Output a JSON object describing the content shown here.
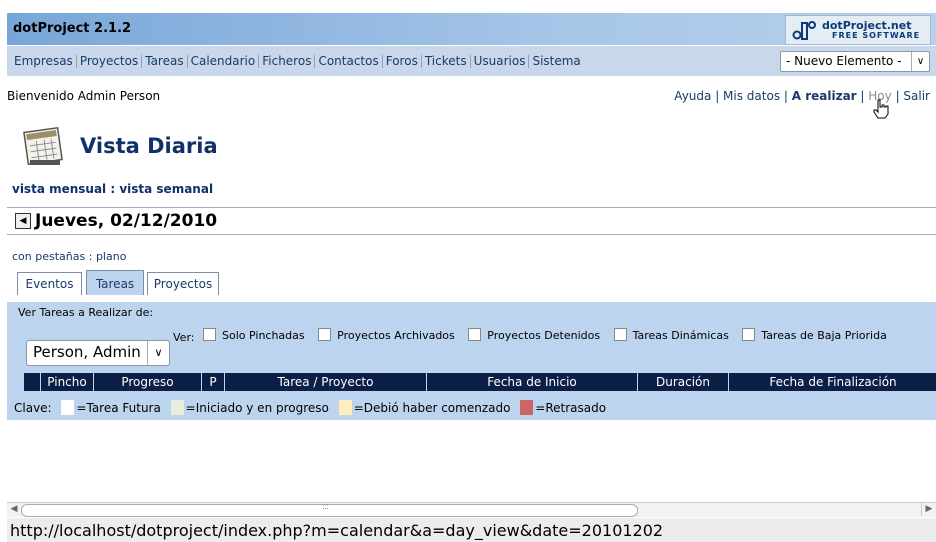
{
  "app": {
    "title": "dotProject 2.1.2",
    "logo_line1": "dotProject.net",
    "logo_line2": "FREE SOFTWARE"
  },
  "menu": {
    "items": [
      "Empresas",
      "Proyectos",
      "Tareas",
      "Calendario",
      "Ficheros",
      "Contactos",
      "Foros",
      "Tickets",
      "Usuarios",
      "Sistema"
    ],
    "new_element": "- Nuevo Elemento -"
  },
  "welcome": "Bienvenido Admin Person",
  "toplinks": {
    "ayuda": "Ayuda",
    "sep": " | ",
    "mis_datos": "Mis datos",
    "a_realizar": "A realizar",
    "hoy": "Hoy",
    "salir": "Salir"
  },
  "page": {
    "title": "Vista Diaria",
    "link_mensual": "vista mensual",
    "link_sep": " : ",
    "link_semanal": "vista semanal"
  },
  "date": {
    "label": "Jueves, 02/12/2010"
  },
  "tabmode": {
    "tabbed": "con pestañas",
    "sep": " : ",
    "flat": "plano"
  },
  "tabs": [
    {
      "label": "Eventos"
    },
    {
      "label": "Tareas"
    },
    {
      "label": "Proyectos"
    }
  ],
  "tasks_filter": {
    "view_label": "Ver Tareas a Realizar de:",
    "user": "Person, Admin",
    "ver_label": "Ver:",
    "checkboxes": [
      "Solo Pinchadas",
      "Proyectos Archivados",
      "Proyectos Detenidos",
      "Tareas Dinámicas",
      "Tareas de Baja Priorida"
    ]
  },
  "table": {
    "columns": [
      "",
      "Pincho",
      "Progreso",
      "P",
      "Tarea / Proyecto",
      "Fecha de Inicio",
      "Duración",
      "Fecha de Finalización"
    ]
  },
  "legend": {
    "label": "Clave:",
    "items": [
      {
        "text": "=Tarea Futura",
        "color": "#ffffff"
      },
      {
        "text": "=Iniciado y en progreso",
        "color": "#e6eedd"
      },
      {
        "text": "=Debió haber comenzado",
        "color": "#ffeebb"
      },
      {
        "text": "=Retrasado",
        "color": "#cc6666"
      }
    ]
  },
  "status": {
    "url": "http://localhost/dotproject/index.php?m=calendar&a=day_view&date=20101202"
  }
}
